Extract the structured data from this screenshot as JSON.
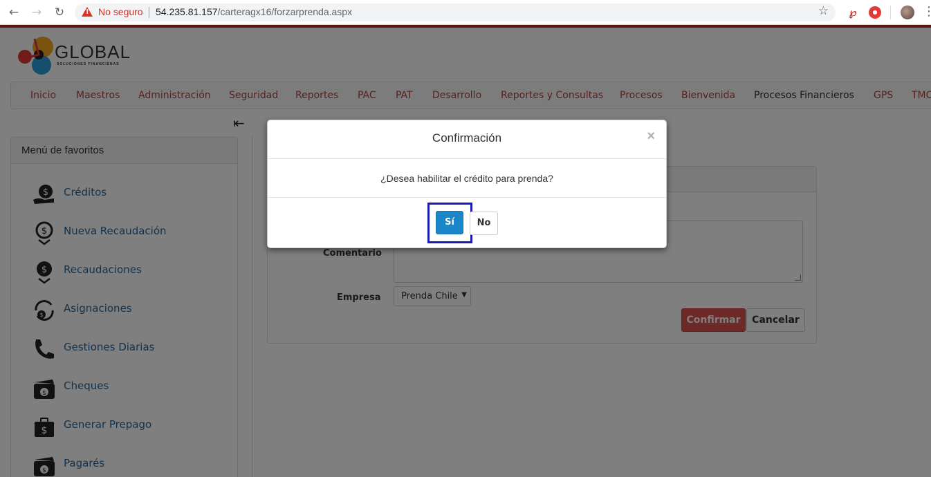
{
  "browser": {
    "security_label": "No seguro",
    "url_host": "54.235.81.157",
    "url_path": "/carteragx16/forzarprenda.aspx"
  },
  "logo": {
    "name": "GLOBAL",
    "tagline": "SOLUCIONES FINANCIERAS"
  },
  "nav": {
    "items": [
      {
        "label": "Inicio"
      },
      {
        "label": "Maestros"
      },
      {
        "label": "Administración"
      },
      {
        "label": "Seguridad"
      },
      {
        "label": "Reportes"
      },
      {
        "label": "PAC"
      },
      {
        "label": "PAT"
      },
      {
        "label": "Desarrollo"
      },
      {
        "label": "Reportes y Consultas"
      },
      {
        "label": "Procesos"
      },
      {
        "label": "Bienvenida"
      },
      {
        "label": "Procesos Financieros"
      },
      {
        "label": "GPS"
      },
      {
        "label": "TMC"
      }
    ]
  },
  "sidebar": {
    "title": "Menú de favoritos",
    "items": [
      {
        "label": "Créditos",
        "icon": "money-bag-icon"
      },
      {
        "label": "Nueva Recaudación",
        "icon": "money-download-icon"
      },
      {
        "label": "Recaudaciones",
        "icon": "money-hand-icon"
      },
      {
        "label": "Asignaciones",
        "icon": "money-cycle-icon"
      },
      {
        "label": "Gestiones Diarias",
        "icon": "phone-icon"
      },
      {
        "label": "Cheques",
        "icon": "wallet-icon"
      },
      {
        "label": "Generar Prepago",
        "icon": "briefcase-money-icon"
      },
      {
        "label": "Pagarés",
        "icon": "wallet-icon"
      }
    ]
  },
  "form": {
    "comment_label": "Comentario",
    "comment_value": "",
    "company_label": "Empresa",
    "company_value": "Prenda Chile",
    "confirm_label": "Confirmar",
    "cancel_label": "Cancelar"
  },
  "modal": {
    "title": "Confirmación",
    "close": "×",
    "message": "¿Desea habilitar el crédito para prenda?",
    "yes_label": "Sí",
    "no_label": "No"
  },
  "colors": {
    "nav_text": "#a94442",
    "link": "#2a6496",
    "primary": "#1b86c7",
    "danger": "#d9534f",
    "focus_box": "#1a1ab8"
  }
}
